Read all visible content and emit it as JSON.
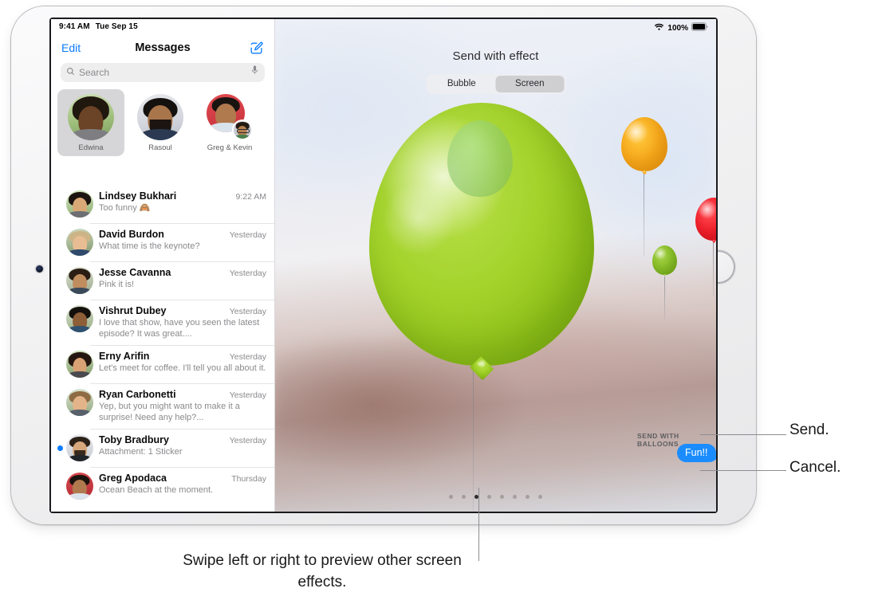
{
  "status_bar": {
    "time": "9:41 AM",
    "date": "Tue Sep 15",
    "battery_percent": "100%",
    "wifi_icon": "wifi-icon",
    "battery_icon": "battery-icon"
  },
  "sidebar": {
    "edit_label": "Edit",
    "title": "Messages",
    "compose_icon": "compose-icon",
    "search": {
      "placeholder": "Search",
      "value": "",
      "search_icon": "search-icon",
      "mic_icon": "microphone-icon"
    },
    "pinned": [
      {
        "name": "Edwina",
        "selected": true
      },
      {
        "name": "Rasoul",
        "selected": false
      },
      {
        "name": "Greg & Kevin",
        "selected": false
      }
    ],
    "conversations": [
      {
        "name": "Lindsey Bukhari",
        "time": "9:22 AM",
        "preview": "Too funny 🙈",
        "unread": false
      },
      {
        "name": "David Burdon",
        "time": "Yesterday",
        "preview": "What time is the keynote?",
        "unread": false
      },
      {
        "name": "Jesse Cavanna",
        "time": "Yesterday",
        "preview": "Pink it is!",
        "unread": false
      },
      {
        "name": "Vishrut Dubey",
        "time": "Yesterday",
        "preview": "I love that show, have you seen the latest episode? It was great....",
        "unread": false
      },
      {
        "name": "Erny Arifin",
        "time": "Yesterday",
        "preview": "Let's meet for coffee. I'll tell you all about it.",
        "unread": false
      },
      {
        "name": "Ryan Carbonetti",
        "time": "Yesterday",
        "preview": "Yep, but you might want to make it a surprise! Need any help?...",
        "unread": false
      },
      {
        "name": "Toby Bradbury",
        "time": "Yesterday",
        "preview": "Attachment: 1 Sticker",
        "unread": true
      },
      {
        "name": "Greg Apodaca",
        "time": "Thursday",
        "preview": "Ocean Beach at the moment.",
        "unread": false
      }
    ]
  },
  "effect_pane": {
    "title": "Send with effect",
    "segments": [
      {
        "label": "Bubble",
        "active": false
      },
      {
        "label": "Screen",
        "active": true
      }
    ],
    "effect_name_label": "SEND WITH BALLOONS",
    "message_bubble_text": "Fun!!",
    "send_icon": "send-arrow-up-icon",
    "cancel_icon": "cancel-x-icon",
    "page_dots": {
      "count": 8,
      "active_index": 2
    }
  },
  "callouts": {
    "send": "Send.",
    "cancel": "Cancel.",
    "swipe": "Swipe left or right to preview other screen effects."
  },
  "colors": {
    "accent_blue": "#0b7bff",
    "bubble_blue": "#1b8cfe",
    "cancel_gray": "#5a5a5e",
    "balloon_green": "#a4d32c",
    "balloon_orange": "#f9ac1c",
    "balloon_red": "#f5232e"
  }
}
